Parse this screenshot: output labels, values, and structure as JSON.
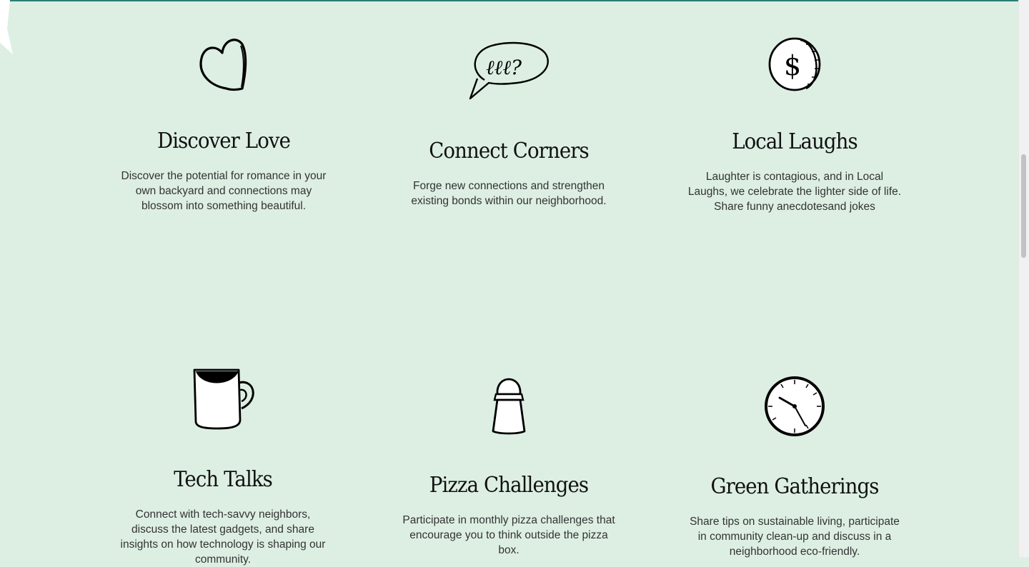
{
  "features": [
    {
      "icon": "heart-icon",
      "title": "Discover Love",
      "description": "Discover the potential for romance in your own backyard and connections may blossom into something beautiful."
    },
    {
      "icon": "speech-bubble-icon",
      "title": "Connect Corners",
      "description": "Forge new connections and strengthen existing bonds within our neighborhood."
    },
    {
      "icon": "coin-icon",
      "title": "Local Laughs",
      "description": "Laughter is contagious, and in Local Laughs, we celebrate the lighter side of life. Share funny anecdotesand jokes"
    },
    {
      "icon": "coffee-mug-icon",
      "title": "Tech Talks",
      "description": "Connect with tech-savvy neighbors, discuss the latest gadgets, and share insights on how technology is shaping our community."
    },
    {
      "icon": "salt-shaker-icon",
      "title": "Pizza Challenges",
      "description": "Participate in monthly pizza challenges that encourage you to think outside the pizza box."
    },
    {
      "icon": "clock-icon",
      "title": "Green Gatherings",
      "description": "Share tips on sustainable living, participate in community clean-up and discuss in a neighborhood eco-friendly."
    }
  ],
  "colors": {
    "background": "#ddefe3",
    "accent": "#2b7d77",
    "text": "#333333"
  }
}
